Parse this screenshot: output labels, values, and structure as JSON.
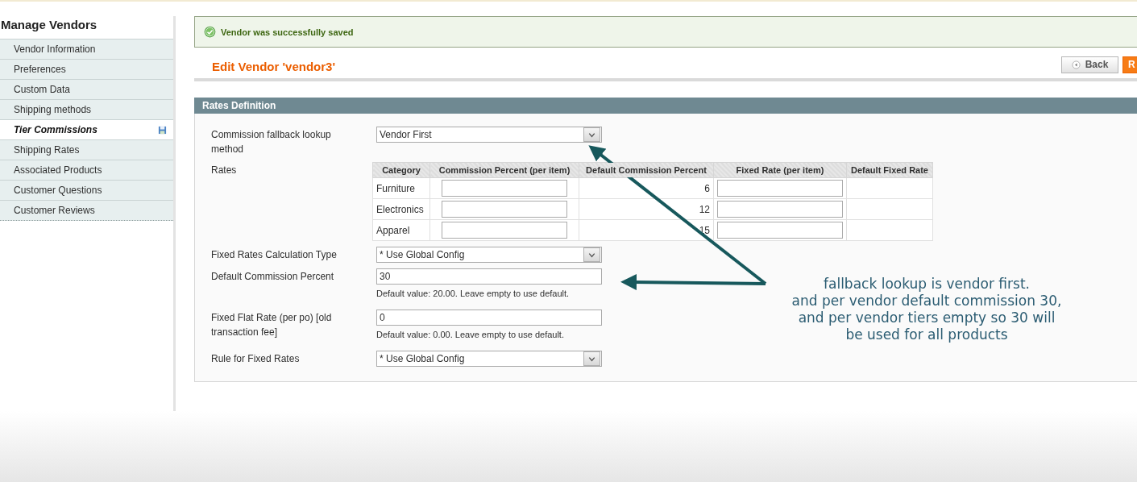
{
  "sidebar": {
    "title": "Manage Vendors",
    "items": [
      {
        "label": "Vendor Information",
        "selected": false
      },
      {
        "label": "Preferences",
        "selected": false
      },
      {
        "label": "Custom Data",
        "selected": false
      },
      {
        "label": "Shipping methods",
        "selected": false
      },
      {
        "label": "Tier Commissions",
        "selected": true
      },
      {
        "label": "Shipping Rates",
        "selected": false
      },
      {
        "label": "Associated Products",
        "selected": false
      },
      {
        "label": "Customer Questions",
        "selected": false
      },
      {
        "label": "Customer Reviews",
        "selected": false
      }
    ]
  },
  "message": {
    "text": "Vendor was successfully saved"
  },
  "header": {
    "title": "Edit Vendor 'vendor3'",
    "buttons": [
      {
        "label": "Back",
        "kind": "back"
      },
      {
        "label": "R",
        "kind": "primary"
      }
    ]
  },
  "section": {
    "title": "Rates Definition",
    "fields": [
      {
        "kind": "select",
        "label": "Commission fallback lookup method",
        "value": "Vendor First"
      },
      {
        "kind": "table",
        "label": "Rates",
        "columns": [
          "Category",
          "Commission Percent (per item)",
          "Default Commission Percent",
          "Fixed Rate (per item)",
          "Default Fixed Rate"
        ],
        "rows": [
          {
            "category": "Furniture",
            "default_commission_percent": "6"
          },
          {
            "category": "Electronics",
            "default_commission_percent": "12"
          },
          {
            "category": "Apparel",
            "default_commission_percent": "15"
          }
        ]
      },
      {
        "kind": "select",
        "label": "Fixed Rates Calculation Type",
        "value": "* Use Global Config"
      },
      {
        "kind": "text",
        "label": "Default Commission Percent",
        "value": "30",
        "note": "Default value: 20.00. Leave empty to use default."
      },
      {
        "kind": "text",
        "label": "Fixed Flat Rate (per po) [old transaction fee]",
        "value": "0",
        "note": "Default value: 0.00. Leave empty to use default."
      },
      {
        "kind": "select",
        "label": "Rule for Fixed Rates",
        "value": "* Use Global Config"
      }
    ]
  },
  "annotation": {
    "lines": [
      "fallback lookup is vendor first.",
      "and per vendor default commission 30,",
      "and per vendor tiers empty so 30 will",
      "be used for all products"
    ]
  }
}
